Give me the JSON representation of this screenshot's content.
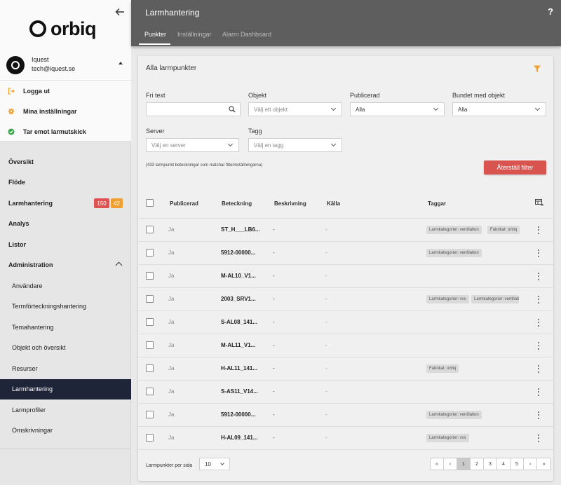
{
  "sidebar": {
    "logo_text": "orbiq",
    "user": {
      "name": "Iquest",
      "email": "tech@iquest.se"
    },
    "actions": [
      {
        "label": "Logga ut",
        "icon": "logout-icon",
        "color": "#f0a030"
      },
      {
        "label": "Mina inställningar",
        "icon": "gear-icon",
        "color": "#f0a030"
      },
      {
        "label": "Tar emot larmutskick",
        "icon": "check-circle-icon",
        "color": "#3aa84a"
      }
    ],
    "nav": [
      {
        "label": "Översikt"
      },
      {
        "label": "Flöde"
      },
      {
        "label": "Larmhantering",
        "badges": [
          "150",
          "42"
        ]
      },
      {
        "label": "Analys"
      },
      {
        "label": "Listor"
      },
      {
        "label": "Administration",
        "expanded": true
      },
      {
        "label": "Användare",
        "sub": true
      },
      {
        "label": "Termförteckningshantering",
        "sub": true
      },
      {
        "label": "Temahantering",
        "sub": true
      },
      {
        "label": "Objekt och översikt",
        "sub": true
      },
      {
        "label": "Resurser",
        "sub": true
      },
      {
        "label": "Larmhantering",
        "sub": true,
        "active": true
      },
      {
        "label": "Larmprofiler",
        "sub": true
      },
      {
        "label": "Omskrivningar",
        "sub": true
      }
    ]
  },
  "header": {
    "title": "Larmhantering",
    "help": "?",
    "tabs": [
      "Punkter",
      "Inställningar",
      "Alarm Dashboard"
    ],
    "active_tab": 0
  },
  "panel": {
    "title": "Alla larmpunkter",
    "filters": {
      "fritext": {
        "label": "Fri text",
        "value": ""
      },
      "objekt": {
        "label": "Objekt",
        "placeholder": "Välj ett objekt"
      },
      "publicerad": {
        "label": "Publicerad",
        "value": "Alla"
      },
      "bundet": {
        "label": "Bundet med objekt",
        "value": "Alla"
      },
      "server": {
        "label": "Server",
        "placeholder": "Välj en server"
      },
      "tagg": {
        "label": "Tagg",
        "placeholder": "Välj en tagg"
      }
    },
    "match_text": "(433 larmpunkt beteckningar som matchar filterinställningarna)",
    "reset_label": "Återställ filter"
  },
  "table": {
    "headers": [
      "Publicerad",
      "Beteckning",
      "Beskrivning",
      "Källa",
      "Taggar"
    ],
    "rows": [
      {
        "publicerad": "Ja",
        "beteckning": "ST_H___LB6...",
        "beskrivning": "-",
        "kalla": "-",
        "tags": [
          "Larmkategorier: ventilation",
          "Fabrikat: orbiq"
        ]
      },
      {
        "publicerad": "Ja",
        "beteckning": "5912-00000...",
        "beskrivning": "-",
        "kalla": "-",
        "tags": [
          "Larmkategorier: ventilation"
        ]
      },
      {
        "publicerad": "Ja",
        "beteckning": "M-AL10_V1...",
        "beskrivning": "-",
        "kalla": "-",
        "tags": []
      },
      {
        "publicerad": "Ja",
        "beteckning": "2003_SRV1...",
        "beskrivning": "-",
        "kalla": "-",
        "tags": [
          "Larmkategorier: vvs",
          "Larmkategorier: ventilation"
        ]
      },
      {
        "publicerad": "Ja",
        "beteckning": "S-AL08_141...",
        "beskrivning": "-",
        "kalla": "-",
        "tags": []
      },
      {
        "publicerad": "Ja",
        "beteckning": "M-AL11_V1...",
        "beskrivning": "-",
        "kalla": "-",
        "tags": []
      },
      {
        "publicerad": "Ja",
        "beteckning": "H-AL11_141...",
        "beskrivning": "-",
        "kalla": "-",
        "tags": [
          "Fabrikat: orbiq"
        ]
      },
      {
        "publicerad": "Ja",
        "beteckning": "S-AS11_V14...",
        "beskrivning": "-",
        "kalla": "-",
        "tags": []
      },
      {
        "publicerad": "Ja",
        "beteckning": "5912-00000...",
        "beskrivning": "-",
        "kalla": "-",
        "tags": [
          "Larmkategorier: ventilation"
        ]
      },
      {
        "publicerad": "Ja",
        "beteckning": "H-AL09_141...",
        "beskrivning": "-",
        "kalla": "-",
        "tags": [
          "Larmkategorier: vvs"
        ]
      }
    ]
  },
  "footer": {
    "per_page_label": "Larmpunkter per sida",
    "per_page_value": "10",
    "pages": [
      "«",
      "‹",
      "1",
      "2",
      "3",
      "4",
      "5",
      "›",
      "»"
    ],
    "current_page": "1"
  }
}
